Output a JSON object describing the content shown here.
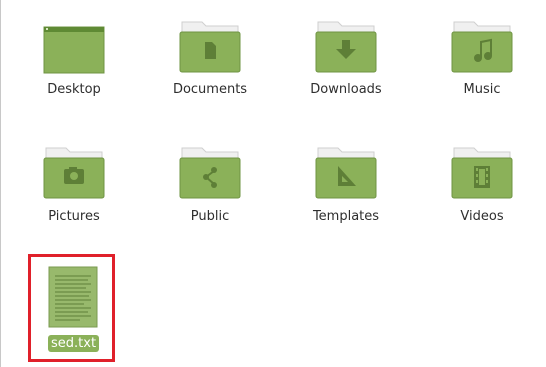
{
  "files": [
    {
      "name": "Desktop",
      "icon": "desktop-folder-icon"
    },
    {
      "name": "Documents",
      "icon": "documents-folder-icon"
    },
    {
      "name": "Downloads",
      "icon": "downloads-folder-icon"
    },
    {
      "name": "Music",
      "icon": "music-folder-icon"
    },
    {
      "name": "Pictures",
      "icon": "pictures-folder-icon"
    },
    {
      "name": "Public",
      "icon": "public-folder-icon"
    },
    {
      "name": "Templates",
      "icon": "templates-folder-icon"
    },
    {
      "name": "Videos",
      "icon": "videos-folder-icon"
    },
    {
      "name": "sed.txt",
      "icon": "text-file-icon",
      "selected": true
    }
  ],
  "colors": {
    "folder_green": "#8bb159",
    "folder_dark": "#6f9443",
    "folder_tab": "#eeeeee",
    "selection_label_bg": "#8bb159",
    "highlight_border": "#e0202a"
  }
}
